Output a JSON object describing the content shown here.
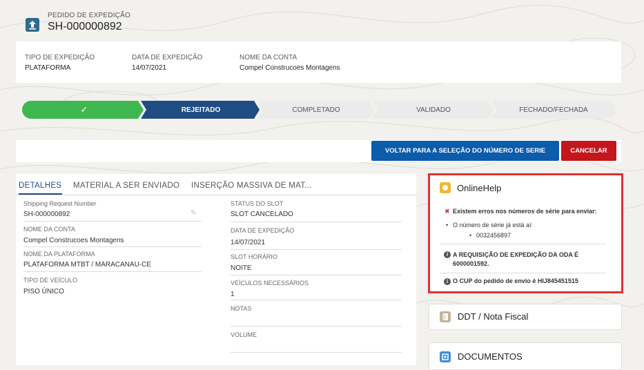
{
  "record": {
    "type_label": "PEDIDO DE EXPEDIÇÃO",
    "name": "SH-000000892"
  },
  "highlights": [
    {
      "label": "TIPO DE EXPEDIÇÃO",
      "value": "PLATAFORMA"
    },
    {
      "label": "DATA DE EXPEDIÇÃO",
      "value": "14/07/2021"
    },
    {
      "label": "NOME DA CONTA",
      "value": "Compel Construcoes Montagens"
    }
  ],
  "path": {
    "completed_mark": "✓",
    "steps": [
      "REJEITADO",
      "COMPLETADO",
      "VALIDADO",
      "FECHADO/FECHADA"
    ],
    "current": "REJEITADO"
  },
  "actions": {
    "back_label": "VOLTAR PARA A SELEÇÃO DO NÚMERO DE SERIE",
    "cancel_label": "CANCELAR"
  },
  "tabs": [
    "DETALHES",
    "MATERIAL A SER ENVIADO",
    "INSERÇÃO MASSIVA DE MAT..."
  ],
  "details": {
    "left": [
      {
        "label": "Shipping Request Number",
        "value": "SH-000000892"
      },
      {
        "label": "NOME DA CONTA",
        "value": "Compel Construcoes Montagens"
      },
      {
        "label": "NOME DA PLATAFORMA",
        "value": "PLATAFORMA MTBT / MARACANAU-CE"
      },
      {
        "label": "TIPO DE VEÍCULO",
        "value": "PISO ÚNICO"
      }
    ],
    "right": [
      {
        "label": "STATUS DO SLOT",
        "value": "SLOT CANCELADO"
      },
      {
        "label": "DATA DE EXPEDIÇÃO",
        "value": "14/07/2021"
      },
      {
        "label": "SLOT HORÁRIO",
        "value": "NOITE"
      },
      {
        "label": "VEÍCULOS NECESSÁRIOS",
        "value": "1"
      },
      {
        "label": "NOTAS",
        "value": ""
      },
      {
        "label": "VOLUME",
        "value": ""
      }
    ]
  },
  "online_help": {
    "title": "OnlineHelp",
    "error_title": "Existem erros nos números de série para enviar:",
    "error_item": "O número de série já está aí:",
    "error_serial": "0032456897",
    "info1": "A REQUISIÇÃO DE EXPEDIÇÃO DA ODA É 6000001592.",
    "info2": "O CUP do pedido de envio é HIJ845451515"
  },
  "ddt": {
    "title": "DDT / Nota Fiscal"
  },
  "documentos": {
    "title": "DOCUMENTOS"
  },
  "colors": {
    "path_complete": "#3fb74f",
    "path_current": "#1f4c82",
    "path_pending": "#ebebeb",
    "button_blue": "#0b5cab",
    "button_red": "#c4161c",
    "highlight_red": "#e03131"
  }
}
